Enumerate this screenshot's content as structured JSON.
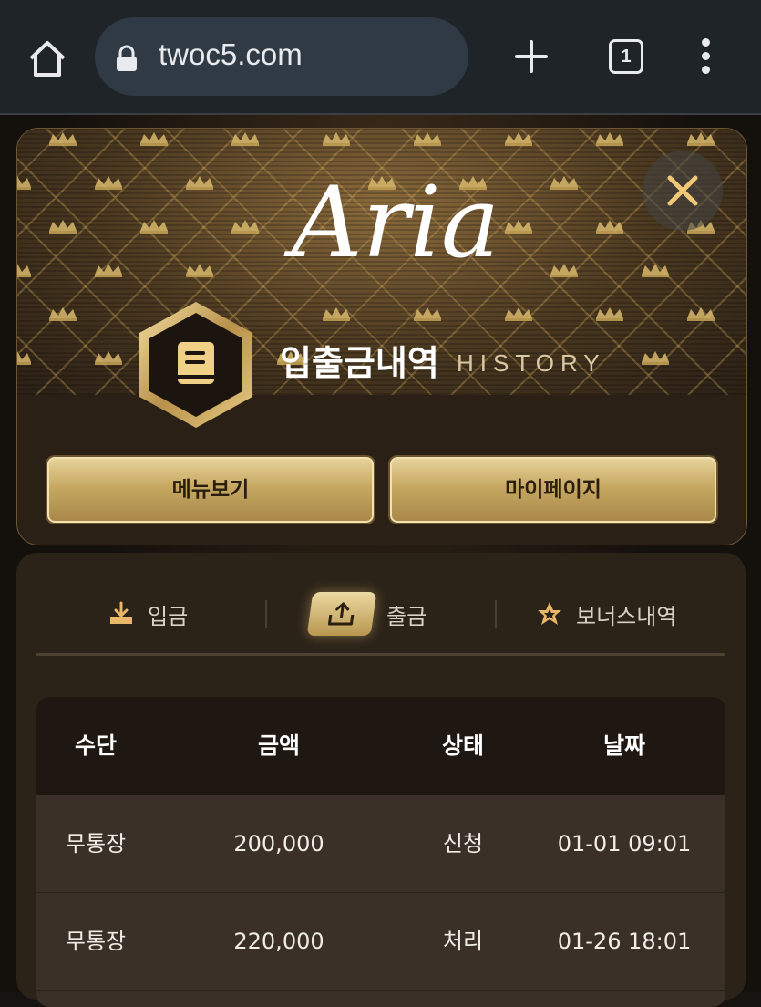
{
  "browser": {
    "url": "twoc5.com",
    "tab_count": "1"
  },
  "header": {
    "logo_text": "Aria",
    "title_ko": "입출금내역",
    "title_en": "HISTORY",
    "menu_button": "메뉴보기",
    "mypage_button": "마이페이지"
  },
  "tabs": {
    "deposit": "입금",
    "withdraw": "출금",
    "bonus": "보너스내역",
    "active": "withdraw"
  },
  "table": {
    "headers": [
      "수단",
      "금액",
      "상태",
      "날짜"
    ],
    "rows": [
      [
        "무통장",
        "200,000",
        "신청",
        "01-01 09:01"
      ],
      [
        "무통장",
        "220,000",
        "처리",
        "01-26 18:01"
      ]
    ]
  },
  "colors": {
    "gold": "#c7a862",
    "gold_light": "#ecd9a2",
    "card_bg": "#2b2218",
    "chrome_bg": "#1f2428"
  }
}
